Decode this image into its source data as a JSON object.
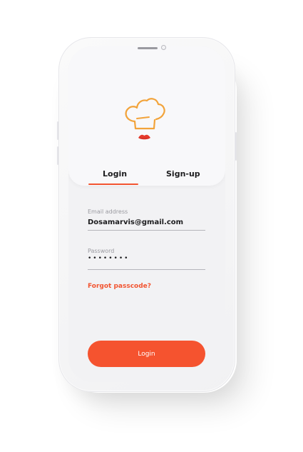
{
  "tabs": {
    "login": "Login",
    "signup": "Sign-up",
    "active": "login"
  },
  "form": {
    "email_label": "Email address",
    "email_value": "Dosamarvis@gmail.com",
    "password_label": "Password",
    "password_mask": "••••••••",
    "forgot_link": "Forgot passcode?"
  },
  "actions": {
    "login_button": "Login"
  },
  "icons": {
    "logo": "chef-hat-with-red-lips-logo"
  },
  "colors": {
    "accent": "#f5532f",
    "logo_hat": "#f2a33a",
    "logo_lips": "#e53a2c"
  }
}
